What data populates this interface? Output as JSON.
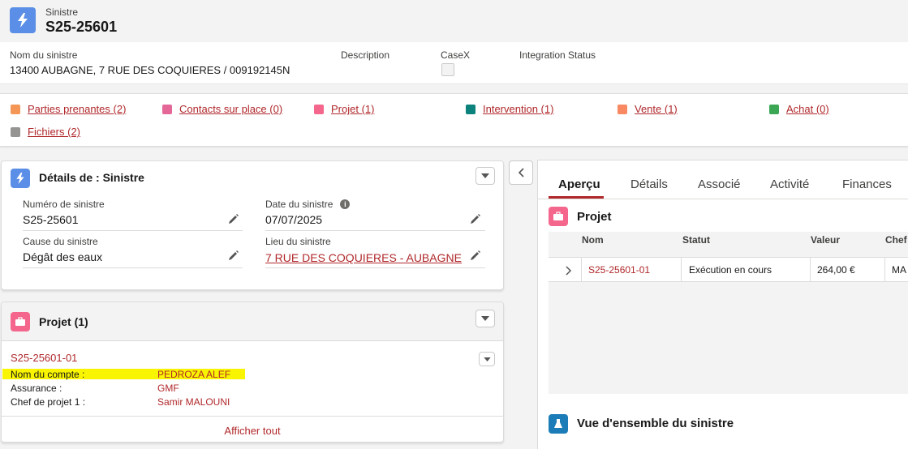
{
  "record": {
    "object_label": "Sinistre",
    "name": "S25-25601"
  },
  "highlights": {
    "nom_label": "Nom du sinistre",
    "nom_value": "13400 AUBAGNE, 7 RUE DES COQUIERES / 009192145N",
    "description_label": "Description",
    "casex_label": "CaseX",
    "integration_label": "Integration Status"
  },
  "related_links": [
    {
      "label": "Parties prenantes (2)",
      "color": "#f49756"
    },
    {
      "label": "Contacts sur place (0)",
      "color": "#e56798"
    },
    {
      "label": "Projet (1)",
      "color": "#f4668c"
    },
    {
      "label": "Intervention (1)",
      "color": "#0b827c"
    },
    {
      "label": "Vente (1)",
      "color": "#f88962"
    },
    {
      "label": "Achat (0)",
      "color": "#3ba755"
    },
    {
      "label": "Fichiers (2)",
      "color": "#969492"
    }
  ],
  "details": {
    "title": "Détails de : Sinistre",
    "numero_label": "Numéro de sinistre",
    "numero_value": "S25-25601",
    "date_label": "Date du sinistre",
    "date_value": "07/07/2025",
    "cause_label": "Cause du sinistre",
    "cause_value": "Dégât des eaux",
    "lieu_label": "Lieu du sinistre",
    "lieu_value": "7 RUE DES COQUIERES - AUBAGNE"
  },
  "projet_card": {
    "title": "Projet (1)",
    "record_link": "S25-25601-01",
    "rows": [
      {
        "label": "Nom du compte :",
        "value": "PEDROZA ALEF"
      },
      {
        "label": "Assurance :",
        "value": "GMF"
      },
      {
        "label": "Chef de projet 1 :",
        "value": "Samir MALOUNI"
      }
    ],
    "view_all": "Afficher tout"
  },
  "tabs": [
    "Aperçu",
    "Détails",
    "Associé",
    "Activité",
    "Finances"
  ],
  "active_tab": "Aperçu",
  "projet_table": {
    "title": "Projet",
    "headers": [
      "Nom",
      "Statut",
      "Valeur",
      "Chef"
    ],
    "row": {
      "nom": "S25-25601-01",
      "statut": "Exécution en cours",
      "valeur": "264,00 €",
      "chef": "MA"
    }
  },
  "overview": {
    "title": "Vue d'ensemble du sinistre"
  },
  "colors": {
    "accent_link": "#b0282b",
    "lightning_icon_bg": "#5b8ee6",
    "projet_icon_bg": "#f4668c",
    "overview_icon_bg": "#1b7cb7",
    "highlight": "#f9f500"
  }
}
